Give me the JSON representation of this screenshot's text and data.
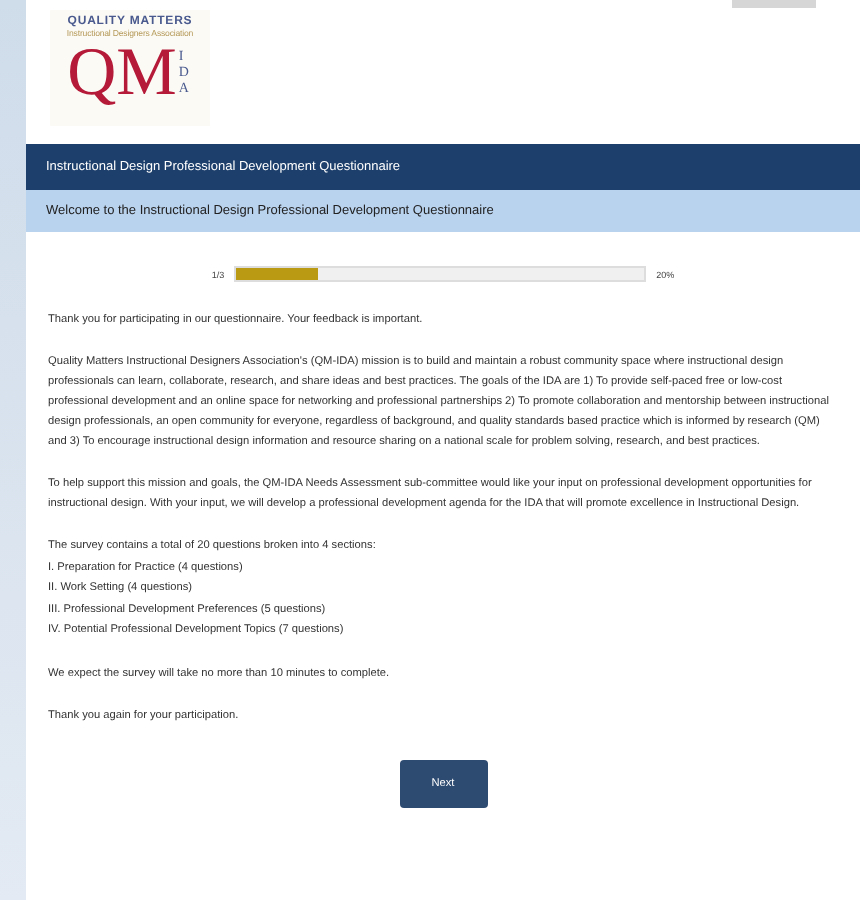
{
  "logo": {
    "top_text": "QUALITY MATTERS",
    "subtitle": "Instructional Designers Association",
    "monogram": "QM",
    "side_letters": "IDA"
  },
  "survey_title": "Instructional Design Professional Development Questionnaire",
  "page_title": "Welcome to the Instructional Design Professional Development Questionnaire",
  "progress": {
    "page": "1/3",
    "level": 0.2,
    "percent": "20%"
  },
  "intro": [
    {
      "kind": "paragraph",
      "text": "Thank you for participating in our questionnaire. Your feedback is important."
    },
    {
      "kind": "paragraph",
      "text": "Quality Matters Instructional Designers Association's (QM-IDA) mission is to build and maintain a robust community space where instructional design professionals can learn, collaborate, research, and share ideas and best practices. The goals of the IDA are 1) To provide self-paced free or low-cost professional development and an online space for networking and professional partnerships 2) To promote collaboration and mentorship between instructional design professionals, an open community for everyone, regardless of background, and quality standards based practice which is informed by research (QM) and 3) To encourage instructional design information and resource sharing on a national scale for problem solving, research, and best practices."
    },
    {
      "kind": "paragraph",
      "text": "To help support this mission and goals, the QM-IDA Needs Assessment sub-committee would like your input on professional development opportunities for instructional design. With your input, we will develop a professional development agenda for the IDA that will promote excellence in Instructional Design."
    },
    {
      "kind": "list",
      "lines": [
        "The survey contains a total of 20 questions broken into 4 sections:",
        "I. Preparation for Practice (4 questions)",
        "II. Work Setting (4 questions)",
        "III. Professional Development Preferences (5 questions)",
        "IV. Potential Professional Development Topics (7 questions)"
      ]
    },
    {
      "kind": "paragraph",
      "text": "We expect the survey will take no more than 10 minutes to complete."
    },
    {
      "kind": "paragraph",
      "text": "Thank you again for your participation."
    }
  ],
  "next_button": "Next"
}
